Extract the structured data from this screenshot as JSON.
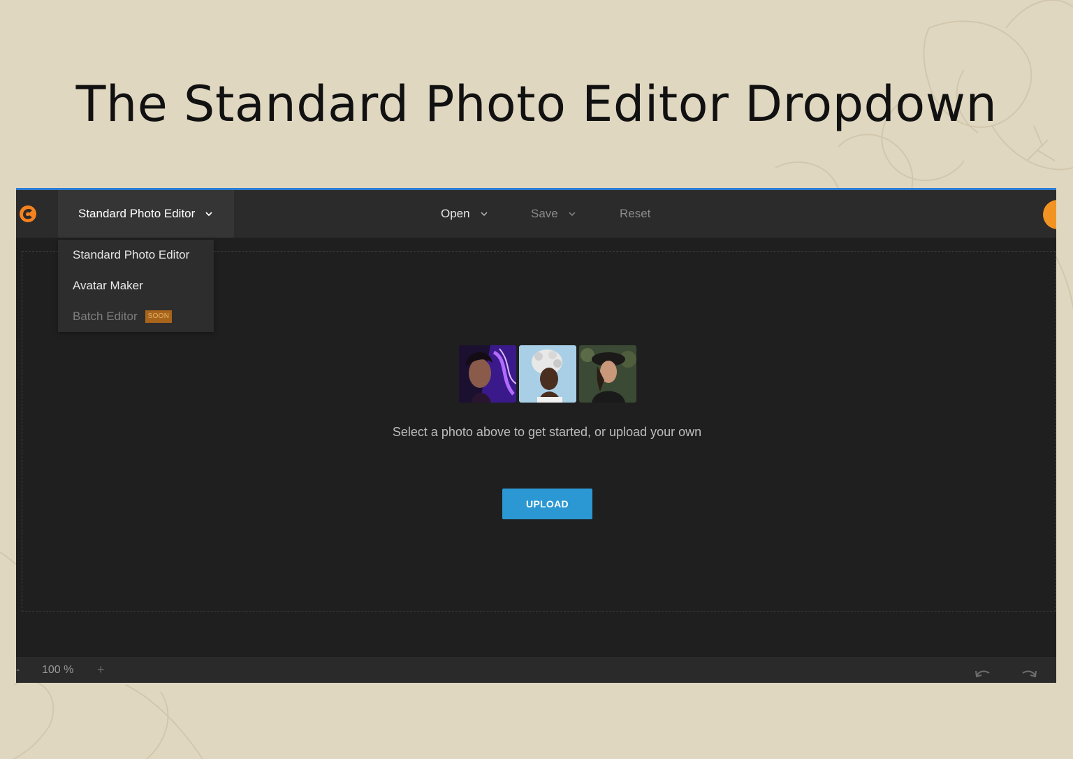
{
  "slide": {
    "title": "The Standard Photo Editor Dropdown"
  },
  "topbar": {
    "mode_select_label": "Standard Photo Editor",
    "nav": {
      "open": "Open",
      "save": "Save",
      "reset": "Reset"
    }
  },
  "dropdown": {
    "items": [
      {
        "label": "Standard Photo Editor",
        "enabled": true
      },
      {
        "label": "Avatar Maker",
        "enabled": true
      },
      {
        "label": "Batch Editor",
        "enabled": false,
        "badge": "SOON"
      }
    ]
  },
  "main": {
    "sample_photos": [
      "sample-photo-neon-portrait",
      "sample-photo-white-braids",
      "sample-photo-dark-hat"
    ],
    "prompt": "Select a photo above to get started, or upload your own",
    "upload_label": "UPLOAD"
  },
  "bottombar": {
    "zoom_minus": "-",
    "zoom_level": "100 %",
    "zoom_plus": "+"
  },
  "colors": {
    "slide_background": "#e0d7c1",
    "app_background": "#1f1f1f",
    "topbar_background": "#2b2b2b",
    "accent_blue": "#2a7bd2",
    "upload_button": "#2b98d4",
    "logo_orange": "#f5821f",
    "soon_badge": "#a8641b"
  },
  "icons": {
    "logo": "app-logo-icon",
    "mode_chevron": "chevron-down-icon",
    "undo": "undo-icon",
    "redo": "redo-icon"
  }
}
